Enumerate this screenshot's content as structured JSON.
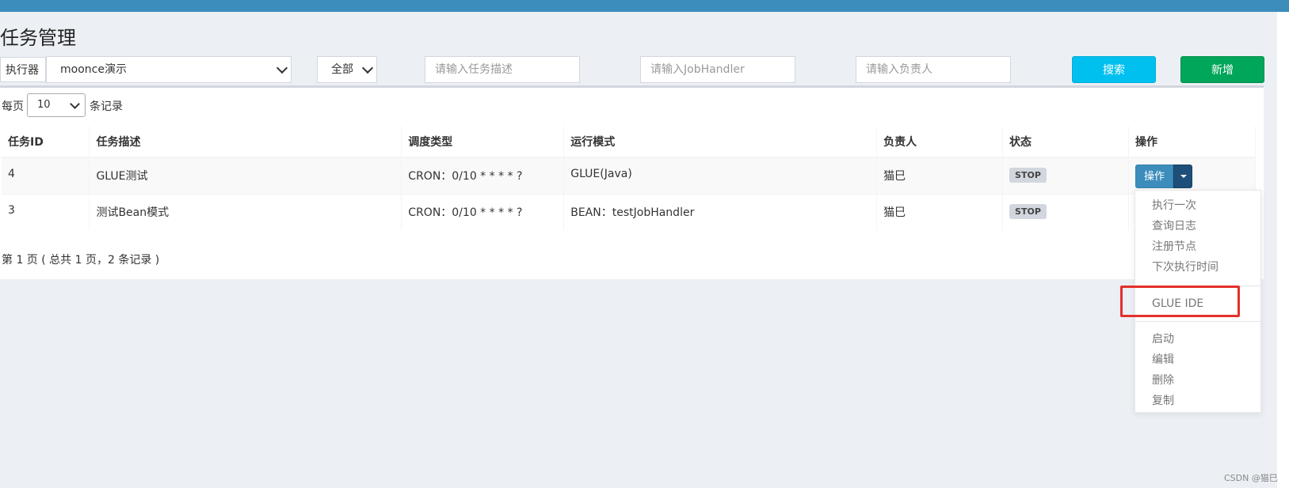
{
  "page": {
    "title": "任务管理"
  },
  "filters": {
    "executor_label": "执行器",
    "executor_value": "moonce演示",
    "status_value": "全部",
    "desc_placeholder": "请输入任务描述",
    "handler_placeholder": "请输入JobHandler",
    "author_placeholder": "请输入负责人",
    "search_label": "搜索",
    "add_label": "新增"
  },
  "length_menu": {
    "prefix": "每页",
    "value": "10",
    "suffix": "条记录"
  },
  "table": {
    "headers": [
      "任务ID",
      "任务描述",
      "调度类型",
      "运行模式",
      "负责人",
      "状态",
      "操作"
    ],
    "rows": [
      {
        "id": "4",
        "desc": "GLUE测试",
        "schedule": "CRON：0/10 * * * * ?",
        "mode": "GLUE(Java)",
        "author": "猫巳",
        "status": "STOP",
        "op": "操作"
      },
      {
        "id": "3",
        "desc": "测试Bean模式",
        "schedule": "CRON：0/10 * * * * ?",
        "mode": "BEAN：testJobHandler",
        "author": "猫巳",
        "status": "STOP"
      }
    ]
  },
  "pagination": {
    "info": "第 1 页 ( 总共 1 页，2 条记录 )"
  },
  "dropdown_menu": {
    "items": [
      "执行一次",
      "查询日志",
      "注册节点",
      "下次执行时间",
      "GLUE IDE",
      "启动",
      "编辑",
      "删除",
      "复制"
    ]
  },
  "watermark": "CSDN @猫巳",
  "colors": {
    "topbar": "#3c8dbc",
    "search_button": "#00c0ef",
    "add_button": "#00a65a",
    "op_button": "#3c8dbc",
    "highlight": "#e4302a"
  }
}
